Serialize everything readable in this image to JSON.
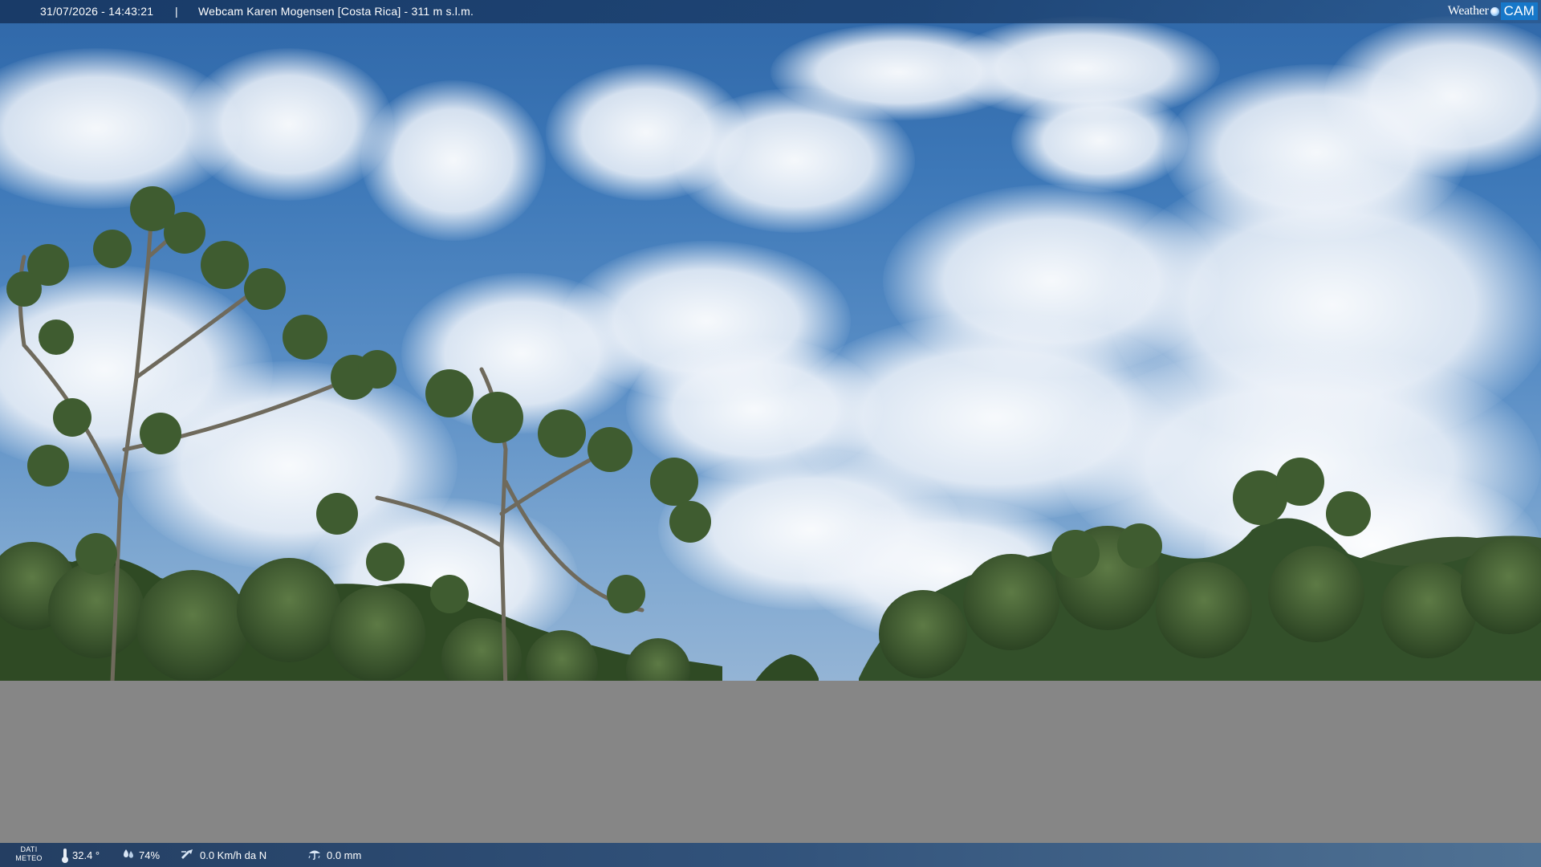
{
  "header": {
    "datetime": "31/07/2026 - 14:43:21",
    "separator": "|",
    "title": "Webcam Karen Mogensen [Costa Rica] - 311 m s.l.m."
  },
  "logo": {
    "word1": "Weather",
    "word2": "CAM"
  },
  "footer": {
    "dati_label_line1": "DATI",
    "dati_label_line2": "METEO",
    "temperature": "32.4 °",
    "humidity": "74%",
    "wind": "0.0 Km/h da N",
    "rain": "0.0 mm"
  },
  "icons": {
    "temperature": "thermometer-icon",
    "humidity": "humidity-drops-icon",
    "wind": "wind-icon",
    "rain": "rain-gauge-icon"
  },
  "colors": {
    "bar_blue": "#1c4070",
    "logo_blue": "#1778c9",
    "sky_top": "#2f67a8",
    "foliage": "#2f4a24",
    "gray_band": "#868686"
  }
}
